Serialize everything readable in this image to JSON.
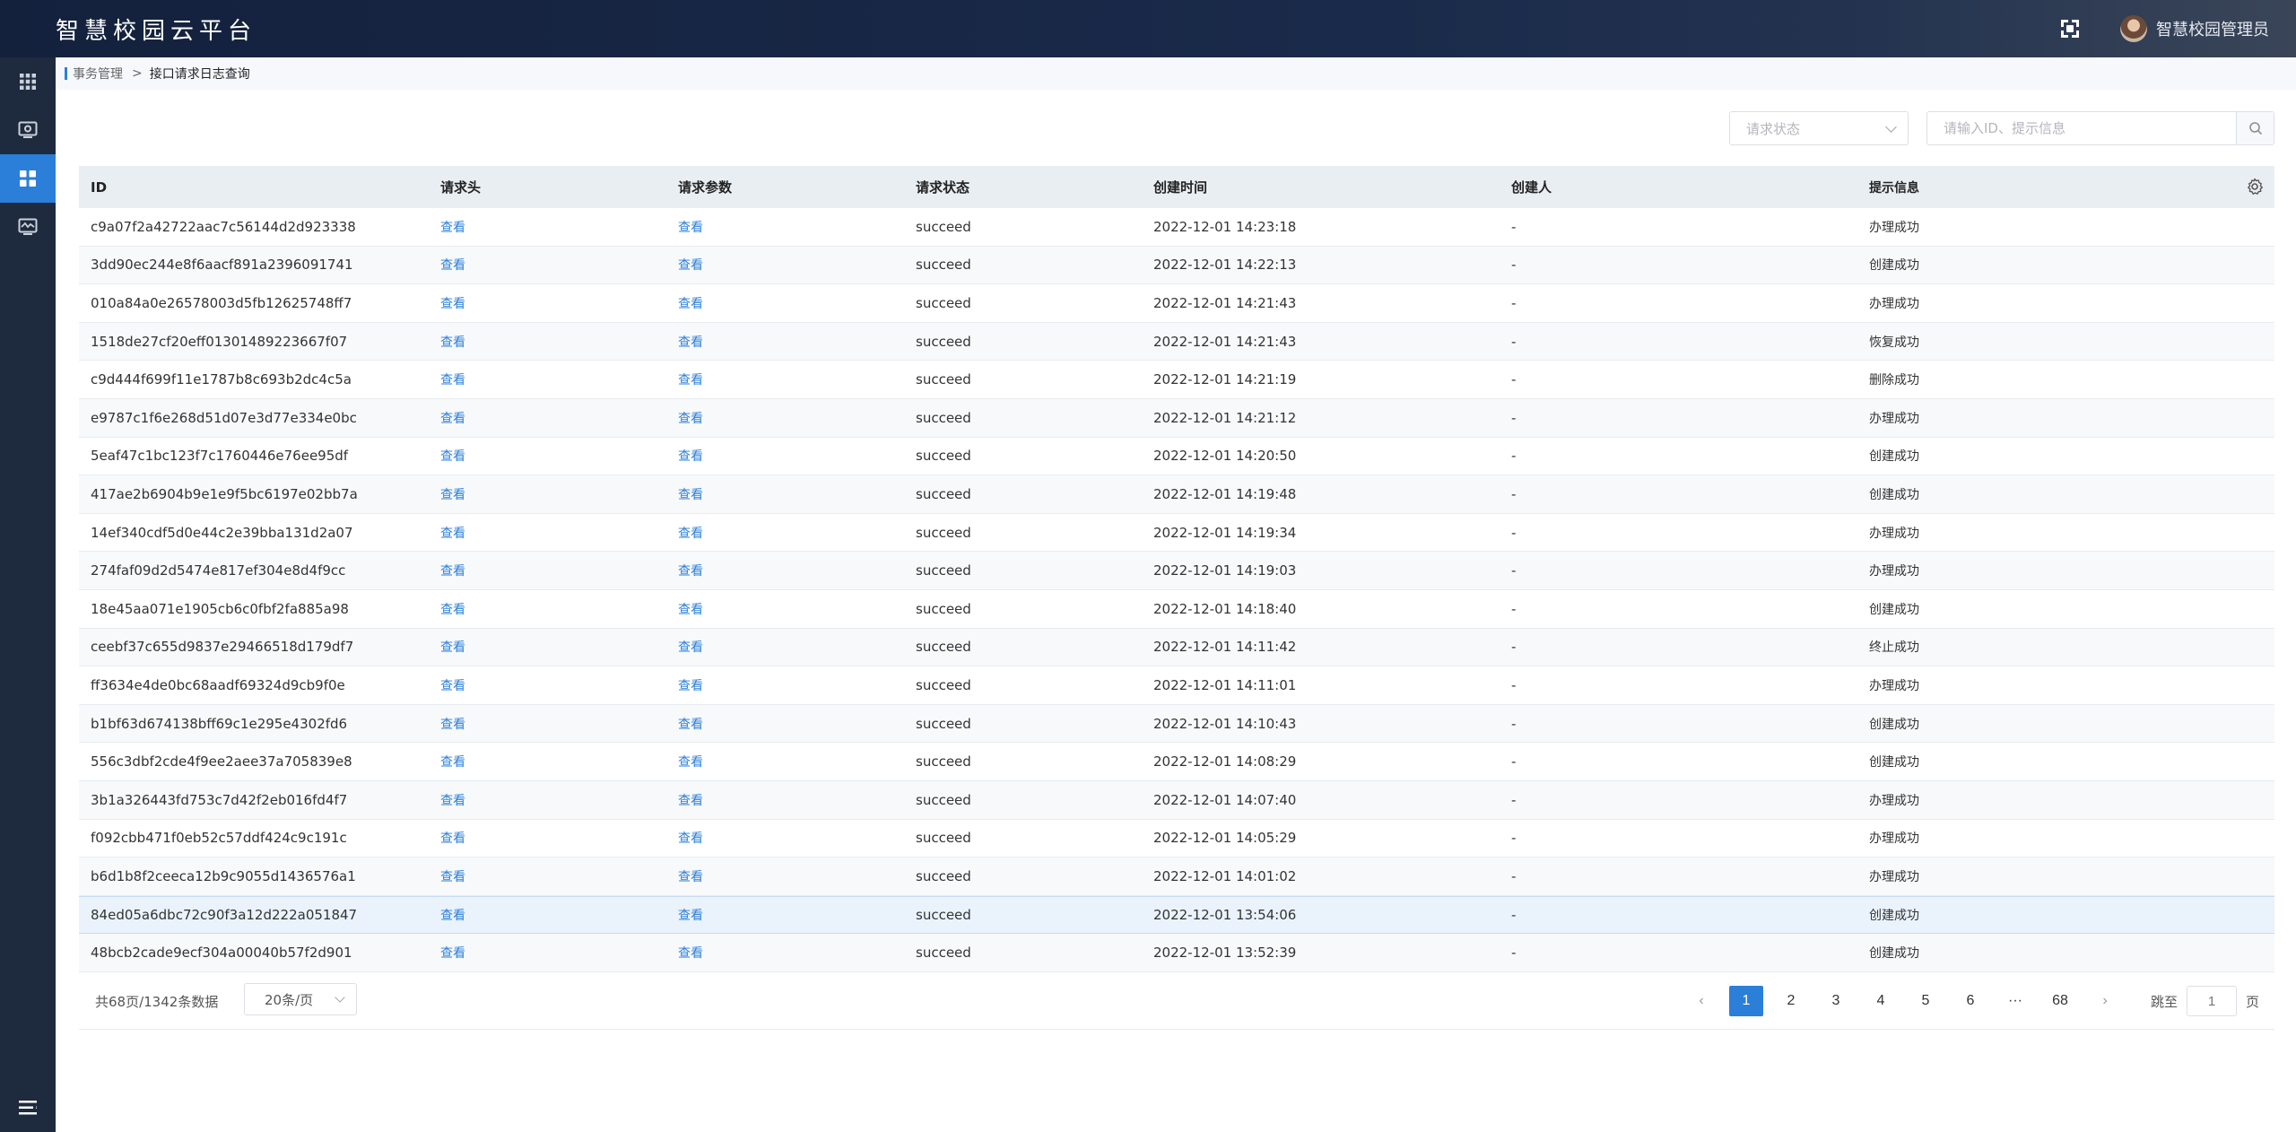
{
  "app": {
    "title": "智慧校园云平台",
    "user": "智慧校园管理员"
  },
  "sidebar": {
    "items": [
      {
        "icon": "grid-icon",
        "active": false
      },
      {
        "icon": "monitor-icon",
        "active": false
      },
      {
        "icon": "dashboard-icon",
        "active": true
      },
      {
        "icon": "chart-screen-icon",
        "active": false
      }
    ],
    "bottom_icon": "menu-collapse-icon"
  },
  "breadcrumb": {
    "parent": "事务管理",
    "separator": ">",
    "current": "接口请求日志查询"
  },
  "filters": {
    "status_placeholder": "请求状态",
    "search_placeholder": "请输入ID、提示信息"
  },
  "table": {
    "columns": [
      "ID",
      "请求头",
      "请求参数",
      "请求状态",
      "创建时间",
      "创建人",
      "提示信息"
    ],
    "view_label": "查看",
    "rows": [
      {
        "id": "c9a07f2a42722aac7c56144d2d923338",
        "status": "succeed",
        "time": "2022-12-01 14:23:18",
        "creator": "-",
        "msg": "办理成功"
      },
      {
        "id": "3dd90ec244e8f6aacf891a2396091741",
        "status": "succeed",
        "time": "2022-12-01 14:22:13",
        "creator": "-",
        "msg": "创建成功"
      },
      {
        "id": "010a84a0e26578003d5fb12625748ff7",
        "status": "succeed",
        "time": "2022-12-01 14:21:43",
        "creator": "-",
        "msg": "办理成功"
      },
      {
        "id": "1518de27cf20eff01301489223667f07",
        "status": "succeed",
        "time": "2022-12-01 14:21:43",
        "creator": "-",
        "msg": "恢复成功"
      },
      {
        "id": "c9d444f699f11e1787b8c693b2dc4c5a",
        "status": "succeed",
        "time": "2022-12-01 14:21:19",
        "creator": "-",
        "msg": "删除成功"
      },
      {
        "id": "e9787c1f6e268d51d07e3d77e334e0bc",
        "status": "succeed",
        "time": "2022-12-01 14:21:12",
        "creator": "-",
        "msg": "办理成功"
      },
      {
        "id": "5eaf47c1bc123f7c1760446e76ee95df",
        "status": "succeed",
        "time": "2022-12-01 14:20:50",
        "creator": "-",
        "msg": "创建成功"
      },
      {
        "id": "417ae2b6904b9e1e9f5bc6197e02bb7a",
        "status": "succeed",
        "time": "2022-12-01 14:19:48",
        "creator": "-",
        "msg": "创建成功"
      },
      {
        "id": "14ef340cdf5d0e44c2e39bba131d2a07",
        "status": "succeed",
        "time": "2022-12-01 14:19:34",
        "creator": "-",
        "msg": "办理成功"
      },
      {
        "id": "274faf09d2d5474e817ef304e8d4f9cc",
        "status": "succeed",
        "time": "2022-12-01 14:19:03",
        "creator": "-",
        "msg": "办理成功"
      },
      {
        "id": "18e45aa071e1905cb6c0fbf2fa885a98",
        "status": "succeed",
        "time": "2022-12-01 14:18:40",
        "creator": "-",
        "msg": "创建成功"
      },
      {
        "id": "ceebf37c655d9837e29466518d179df7",
        "status": "succeed",
        "time": "2022-12-01 14:11:42",
        "creator": "-",
        "msg": "终止成功"
      },
      {
        "id": "ff3634e4de0bc68aadf69324d9cb9f0e",
        "status": "succeed",
        "time": "2022-12-01 14:11:01",
        "creator": "-",
        "msg": "办理成功"
      },
      {
        "id": "b1bf63d674138bff69c1e295e4302fd6",
        "status": "succeed",
        "time": "2022-12-01 14:10:43",
        "creator": "-",
        "msg": "创建成功"
      },
      {
        "id": "556c3dbf2cde4f9ee2aee37a705839e8",
        "status": "succeed",
        "time": "2022-12-01 14:08:29",
        "creator": "-",
        "msg": "创建成功"
      },
      {
        "id": "3b1a326443fd753c7d42f2eb016fd4f7",
        "status": "succeed",
        "time": "2022-12-01 14:07:40",
        "creator": "-",
        "msg": "办理成功"
      },
      {
        "id": "f092cbb471f0eb52c57ddf424c9c191c",
        "status": "succeed",
        "time": "2022-12-01 14:05:29",
        "creator": "-",
        "msg": "办理成功"
      },
      {
        "id": "b6d1b8f2ceeca12b9c9055d1436576a1",
        "status": "succeed",
        "time": "2022-12-01 14:01:02",
        "creator": "-",
        "msg": "办理成功"
      },
      {
        "id": "84ed05a6dbc72c90f3a12d222a051847",
        "status": "succeed",
        "time": "2022-12-01 13:54:06",
        "creator": "-",
        "msg": "创建成功",
        "highlighted": true
      },
      {
        "id": "48bcb2cade9ecf304a00040b57f2d901",
        "status": "succeed",
        "time": "2022-12-01 13:52:39",
        "creator": "-",
        "msg": "创建成功"
      }
    ]
  },
  "pagination": {
    "total_text": "共68页/1342条数据",
    "page_size": "20条/页",
    "pages": [
      "1",
      "2",
      "3",
      "4",
      "5",
      "6",
      "···",
      "68"
    ],
    "current": "1",
    "goto_label": "跳至",
    "goto_value": "1",
    "goto_suffix": "页"
  },
  "colors": {
    "primary": "#2b7fd8",
    "header_bg": "#14213d",
    "sidebar_bg": "#1e2a3d",
    "table_head_bg": "#e9eef3"
  }
}
